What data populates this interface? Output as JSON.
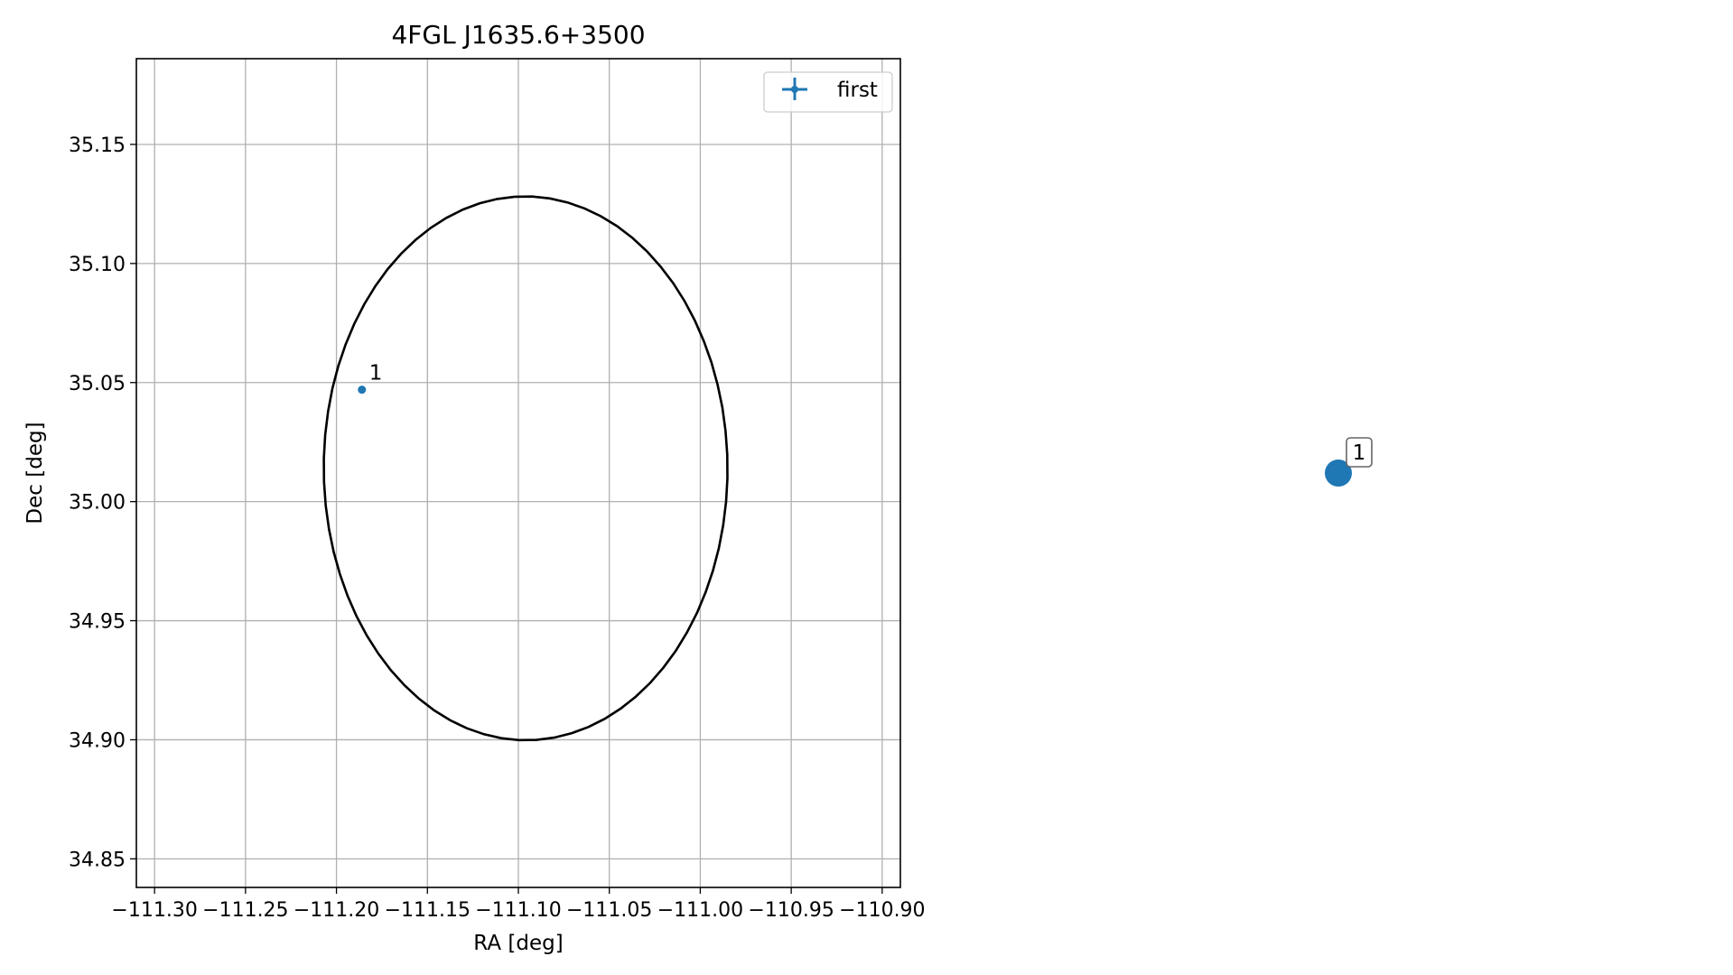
{
  "chart_data": [
    {
      "type": "scatter",
      "title": "4FGL J1635.6+3500",
      "xlabel": "RA [deg]",
      "ylabel": "Dec [deg]",
      "xlim": [
        -111.31,
        -110.89
      ],
      "ylim": [
        34.838,
        35.186
      ],
      "grid": true,
      "legend": {
        "position": "top-right",
        "entries": [
          "first"
        ]
      },
      "x_ticks": [
        -111.3,
        -111.25,
        -111.2,
        -111.15,
        -111.1,
        -111.05,
        -111.0,
        -110.95,
        -110.9
      ],
      "x_tick_labels": [
        "−111.30",
        "−111.25",
        "−111.20",
        "−111.15",
        "−111.10",
        "−111.05",
        "−111.00",
        "−110.95",
        "−110.90"
      ],
      "y_ticks": [
        34.85,
        34.9,
        34.95,
        35.0,
        35.05,
        35.1,
        35.15
      ],
      "y_tick_labels": [
        "34.85",
        "34.90",
        "34.95",
        "35.00",
        "35.05",
        "35.10",
        "35.15"
      ],
      "series": [
        {
          "name": "first",
          "color": "#1f77b4",
          "points": [
            {
              "x": -111.186,
              "y": 35.047,
              "label": "1"
            }
          ]
        }
      ],
      "ellipse": {
        "color": "#000000",
        "center_ra": -111.096,
        "center_dec": 35.014,
        "semi_major": 0.1142,
        "semi_minor": 0.111,
        "angle_deg": 93.0
      }
    },
    {
      "type": "scatter",
      "title": "",
      "xlabel": "",
      "ylabel": "",
      "grid": false,
      "series": [
        {
          "color": "#1f77b4",
          "points": [
            {
              "x": 0,
              "y": 0,
              "label": "1"
            }
          ]
        }
      ]
    }
  ]
}
